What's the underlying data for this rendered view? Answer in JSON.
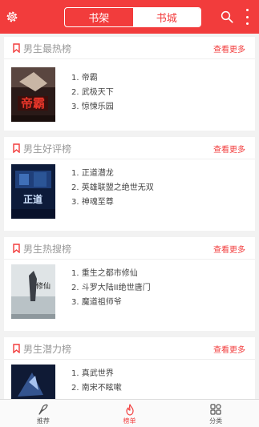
{
  "header": {
    "tabs": [
      "书架",
      "书城"
    ],
    "active_tab": "书城",
    "accent_color": "#f23c3c"
  },
  "sections": [
    {
      "title": "男生最热榜",
      "more": "查看更多",
      "cover_icon": "book-cover-1",
      "books": [
        "1. 帝霸",
        "2. 武极天下",
        "3. 惊悚乐园"
      ]
    },
    {
      "title": "男生好评榜",
      "more": "查看更多",
      "cover_icon": "book-cover-2",
      "books": [
        "1. 正道潜龙",
        "2. 英雄联盟之绝世无双",
        "3. 神魂至尊"
      ]
    },
    {
      "title": "男生热搜榜",
      "more": "查看更多",
      "cover_icon": "book-cover-3",
      "books": [
        "1. 重生之都市修仙",
        "2. 斗罗大陆II绝世唐门",
        "3. 魔道祖师爷"
      ]
    },
    {
      "title": "男生潜力榜",
      "more": "查看更多",
      "cover_icon": "book-cover-4",
      "books": [
        "1. 真武世界",
        "2. 南宋不眩嗽"
      ]
    }
  ],
  "bottom_nav": [
    {
      "label": "推荐",
      "icon": "feather-icon",
      "active": false
    },
    {
      "label": "榜单",
      "icon": "flame-icon",
      "active": true
    },
    {
      "label": "分类",
      "icon": "grid-icon",
      "active": false
    }
  ]
}
